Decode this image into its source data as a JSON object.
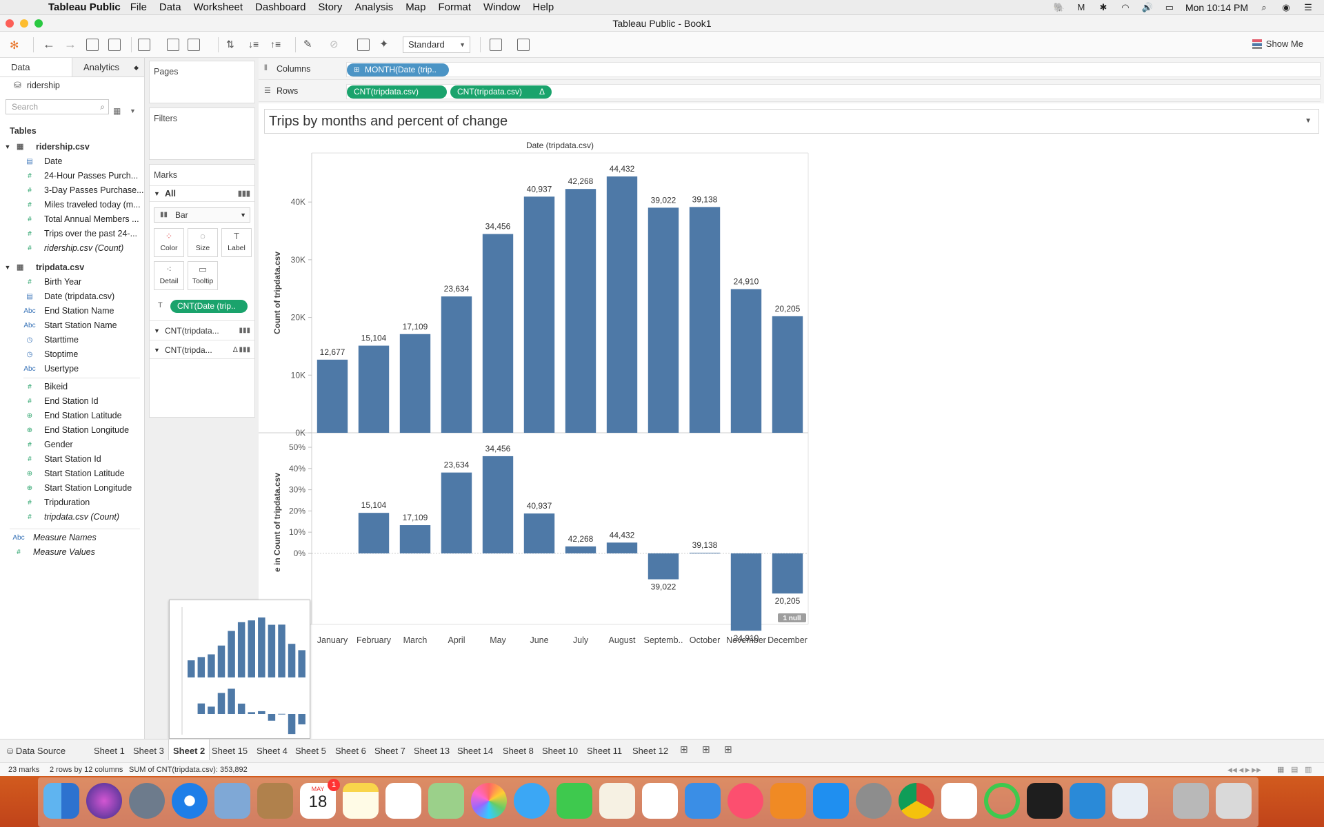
{
  "menubar": {
    "app_name": "Tableau Public",
    "items": [
      "File",
      "Data",
      "Worksheet",
      "Dashboard",
      "Story",
      "Analysis",
      "Map",
      "Format",
      "Window",
      "Help"
    ],
    "clock": "Mon 10:14 PM"
  },
  "window": {
    "title": "Tableau Public - Book1"
  },
  "toolbar": {
    "fit_select": "Standard",
    "show_me": "Show Me"
  },
  "data_pane": {
    "tabs": [
      "Data",
      "Analytics"
    ],
    "datasource": "ridership",
    "search_placeholder": "Search",
    "tables_header": "Tables",
    "tables": [
      {
        "name": "ridership.csv",
        "fields": [
          {
            "name": "Date",
            "type": "date"
          },
          {
            "name": "24-Hour Passes Purch...",
            "type": "measure"
          },
          {
            "name": "3-Day Passes Purchase...",
            "type": "measure"
          },
          {
            "name": "Miles traveled today (m...",
            "type": "measure"
          },
          {
            "name": "Total Annual Members ...",
            "type": "measure"
          },
          {
            "name": "Trips over the past 24-...",
            "type": "measure"
          },
          {
            "name": "ridership.csv (Count)",
            "type": "measure-italic"
          }
        ]
      },
      {
        "name": "tripdata.csv",
        "fields": [
          {
            "name": "Birth Year",
            "type": "measure"
          },
          {
            "name": "Date (tripdata.csv)",
            "type": "date"
          },
          {
            "name": "End Station Name",
            "type": "string"
          },
          {
            "name": "Start Station Name",
            "type": "string"
          },
          {
            "name": "Starttime",
            "type": "datetime"
          },
          {
            "name": "Stoptime",
            "type": "datetime"
          },
          {
            "name": "Usertype",
            "type": "string"
          },
          {
            "name": "Bikeid",
            "type": "measure"
          },
          {
            "name": "End Station Id",
            "type": "measure"
          },
          {
            "name": "End Station Latitude",
            "type": "geo"
          },
          {
            "name": "End Station Longitude",
            "type": "geo"
          },
          {
            "name": "Gender",
            "type": "measure"
          },
          {
            "name": "Start Station Id",
            "type": "measure"
          },
          {
            "name": "Start Station Latitude",
            "type": "geo"
          },
          {
            "name": "Start Station Longitude",
            "type": "geo"
          },
          {
            "name": "Tripduration",
            "type": "measure"
          },
          {
            "name": "tripdata.csv (Count)",
            "type": "measure-italic"
          }
        ]
      }
    ],
    "extra": [
      {
        "name": "Measure Names",
        "type": "string"
      },
      {
        "name": "Measure Values",
        "type": "measure"
      }
    ]
  },
  "cards": {
    "pages": "Pages",
    "filters": "Filters",
    "marks": "Marks",
    "all": "All",
    "mark_type": "Bar",
    "buttons": [
      "Color",
      "Size",
      "Label",
      "Detail",
      "Tooltip"
    ],
    "label_pill": "CNT(Date (trip..",
    "sub_marks": [
      "CNT(tripdata...",
      "CNT(tripda..."
    ]
  },
  "shelves": {
    "columns_label": "Columns",
    "rows_label": "Rows",
    "columns_pill": "MONTH(Date (trip..",
    "rows_pills": [
      "CNT(tripdata.csv)",
      "CNT(tripdata.csv)"
    ]
  },
  "worksheet": {
    "title": "Trips by months and percent of change",
    "null_badge": "1 null"
  },
  "chart_data": [
    {
      "type": "bar",
      "title": "Date (tripdata.csv)",
      "ylabel": "Count of tripdata.csv",
      "categories": [
        "January",
        "February",
        "March",
        "April",
        "May",
        "June",
        "July",
        "August",
        "Septemb..",
        "October",
        "November",
        "December"
      ],
      "values": [
        12677,
        15104,
        17109,
        23634,
        34456,
        40937,
        42268,
        44432,
        39022,
        39138,
        24910,
        20205
      ],
      "data_labels": [
        "12,677",
        "15,104",
        "17,109",
        "23,634",
        "34,456",
        "40,937",
        "42,268",
        "44,432",
        "39,022",
        "39,138",
        "24,910",
        "20,205"
      ],
      "ylim": [
        0,
        48500
      ],
      "yticks": [
        "0K",
        "10K",
        "20K",
        "30K",
        "40K"
      ]
    },
    {
      "type": "bar",
      "ylabel": "e in Count of tripdata.csv",
      "categories": [
        "January",
        "February",
        "March",
        "April",
        "May",
        "June",
        "July",
        "August",
        "Septemb..",
        "October",
        "November",
        "December"
      ],
      "values": [
        null,
        19.1,
        13.3,
        38.1,
        45.8,
        18.8,
        3.3,
        5.1,
        -12.2,
        0.3,
        -36.4,
        -18.9
      ],
      "data_labels": [
        "",
        "15,104",
        "17,109",
        "23,634",
        "34,456",
        "40,937",
        "42,268",
        "44,432",
        "39,022",
        "39,138",
        "24,910",
        "20,205"
      ],
      "ylim": [
        -40,
        52
      ],
      "yticks": [
        "0%",
        "10%",
        "20%",
        "30%",
        "40%",
        "50%"
      ]
    }
  ],
  "sheet_tabs": {
    "data_source": "Data Source",
    "sheets": [
      "Sheet 1",
      "Sheet 3",
      "Sheet 2",
      "Sheet 15",
      "Sheet 4",
      "Sheet 5",
      "Sheet 6",
      "Sheet 7",
      "Sheet 13",
      "Sheet 14",
      "Sheet 8",
      "Sheet 10",
      "Sheet 11",
      "Sheet 12"
    ],
    "active": "Sheet 2"
  },
  "status": {
    "marks": "23 marks",
    "dims": "2 rows by 12 columns",
    "sum": "SUM of CNT(tripdata.csv): 353,892"
  },
  "dock": {
    "calendar_month": "MAY",
    "calendar_day": "18",
    "calendar_badge": "1"
  }
}
